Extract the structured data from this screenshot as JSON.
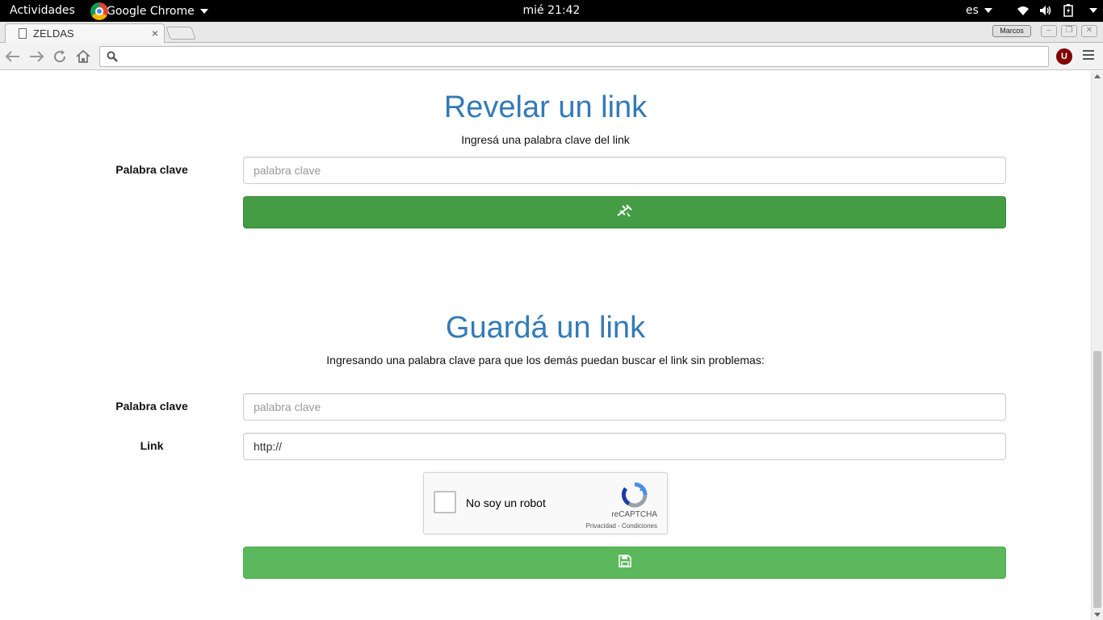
{
  "topbar": {
    "activities": "Actividades",
    "app_name": "Google Chrome",
    "clock": "mié 21:42",
    "lang": "es"
  },
  "browser": {
    "tab_title": "ZELDAS",
    "tab_close": "×",
    "profile": "Marcos",
    "omnibox_value": ""
  },
  "reveal": {
    "title": "Revelar un link",
    "subtitle": "Ingresá una palabra clave del link",
    "keyword_label": "Palabra clave",
    "keyword_placeholder": "palabra clave"
  },
  "save": {
    "title": "Guardá un link",
    "subtitle": "Ingresando una palabra clave para que los demás puedan buscar el link sin problemas:",
    "keyword_label": "Palabra clave",
    "keyword_placeholder": "palabra clave",
    "link_label": "Link",
    "link_value": "http://"
  },
  "captcha": {
    "label": "No soy un robot",
    "brand": "reCAPTCHA",
    "terms": "Privacidad - Condiciones"
  },
  "colors": {
    "title_blue": "#337ab7",
    "btn_dark_green": "#449d44",
    "btn_green": "#5cb85c"
  },
  "icons": {
    "reveal_button": "zelda-sword-icon",
    "save_button": "floppy-disk-icon"
  }
}
